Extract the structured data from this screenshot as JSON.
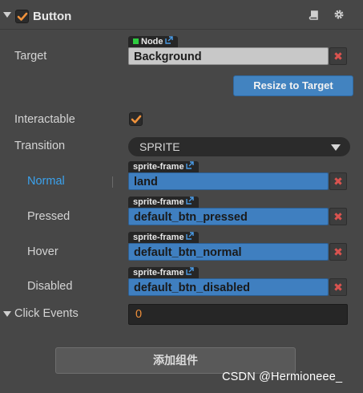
{
  "header": {
    "title": "Button",
    "enabled": true,
    "icons": [
      "collapse-triangle-icon",
      "book-icon",
      "gear-icon"
    ]
  },
  "target": {
    "label": "Target",
    "tag": "Node",
    "value": "Background",
    "clear": "✖"
  },
  "resize_button": "Resize to Target",
  "interactable": {
    "label": "Interactable",
    "checked": true
  },
  "transition": {
    "label": "Transition",
    "value": "SPRITE"
  },
  "states": [
    {
      "label": "Normal",
      "tag": "sprite-frame",
      "value": "land",
      "clear": "✖"
    },
    {
      "label": "Pressed",
      "tag": "sprite-frame",
      "value": "default_btn_pressed",
      "clear": "✖"
    },
    {
      "label": "Hover",
      "tag": "sprite-frame",
      "value": "default_btn_normal",
      "clear": "✖"
    },
    {
      "label": "Disabled",
      "tag": "sprite-frame",
      "value": "default_btn_disabled",
      "clear": "✖"
    }
  ],
  "click_events": {
    "label": "Click Events",
    "value": "0"
  },
  "add_component": "添加组件",
  "watermark": "CSDN @Hermioneee_",
  "colors": {
    "panel_bg": "#474747",
    "accent_orange": "#f0923b",
    "field_blue": "#3f7fc0",
    "normal_label_blue": "#3ba3ef",
    "node_green": "#2ecc40",
    "clear_red": "#d9534f"
  }
}
